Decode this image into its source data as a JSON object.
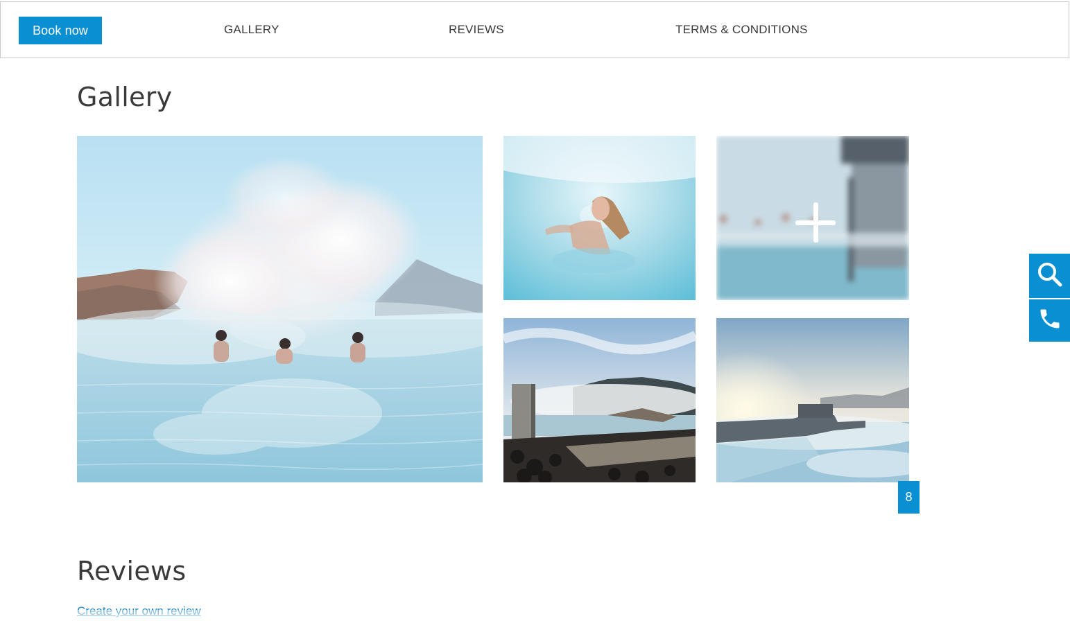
{
  "nav": {
    "book_label": "Book now",
    "links": [
      "GALLERY",
      "REVIEWS",
      "TERMS & CONDITIONS"
    ]
  },
  "gallery": {
    "title": "Gallery",
    "photo_count": "8"
  },
  "reviews": {
    "title": "Reviews",
    "create_link": "Create your own review"
  },
  "icons": {
    "search": "search-icon",
    "phone": "phone-icon",
    "plus": "plus-icon"
  },
  "colors": {
    "accent": "#0a8fd2",
    "link": "#1f86c7",
    "text": "#3a3a3a"
  }
}
